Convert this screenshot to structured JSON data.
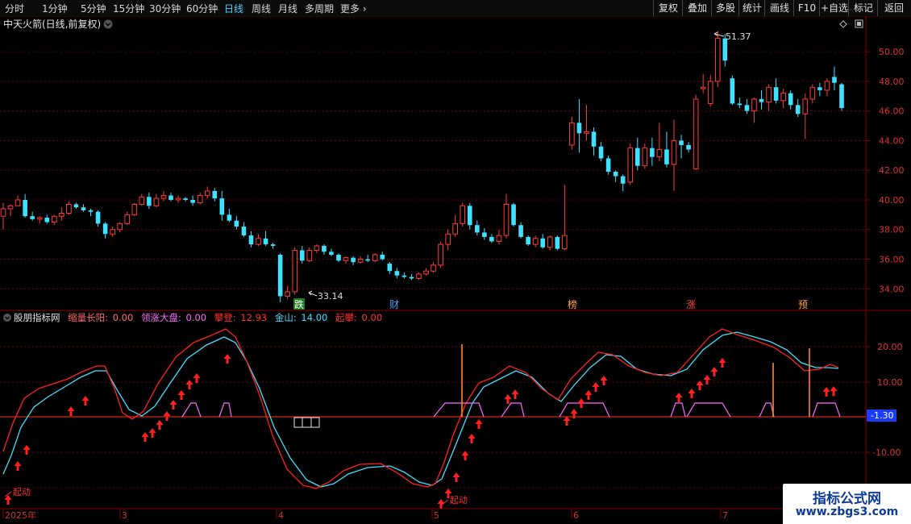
{
  "toolbar": {
    "periods": [
      "分时",
      "1分钟",
      "5分钟",
      "15分钟",
      "30分钟",
      "60分钟",
      "日线",
      "周线",
      "月线",
      "多周期",
      "更多"
    ],
    "active_period": "日线",
    "right_buttons": [
      "复权",
      "叠加",
      "多股",
      "统计",
      "画线",
      "F10",
      "+自选",
      "标记",
      "返回"
    ]
  },
  "header": {
    "title": "中天火箭(日线,前复权)"
  },
  "price_axis": {
    "ticks": [
      "50.00",
      "48.00",
      "46.00",
      "44.00",
      "42.00",
      "40.00",
      "38.00",
      "36.00",
      "34.00"
    ],
    "range": [
      32.6,
      52.4
    ]
  },
  "annotations": {
    "high_label": "51.37",
    "low_label": "33.14"
  },
  "events": [
    {
      "label": "跌",
      "fg": "#ffffff",
      "bg": "#1e7a1e"
    },
    {
      "label": "财",
      "fg": "#4aa3ff",
      "bg": "#000000"
    },
    {
      "label": "榜",
      "fg": "#ffa040",
      "bg": "#000000"
    },
    {
      "label": "涨",
      "fg": "#ff4040",
      "bg": "#000000"
    },
    {
      "label": "预",
      "fg": "#ffa040",
      "bg": "#000000"
    }
  ],
  "indicator": {
    "name": "股朋指标网",
    "fields": [
      {
        "label": "缩量长阳:",
        "value": "0.00",
        "color": "#ff6a6a"
      },
      {
        "label": "领涨大盘:",
        "value": "0.00",
        "color": "#ff66ff"
      },
      {
        "label": "攀登:",
        "value": "12.93",
        "color": "#ff3030"
      },
      {
        "label": "金山:",
        "value": "14.00",
        "color": "#40e0ff"
      },
      {
        "label": "起攀:",
        "value": "0.00",
        "color": "#ff3030"
      }
    ],
    "axis_ticks": [
      "20.00",
      "10.00",
      "-10.00"
    ],
    "current_value": "-1.30",
    "start_labels": [
      "起动",
      "起动"
    ]
  },
  "date_axis": {
    "labels": [
      "2025年",
      "3",
      "4",
      "5",
      "6",
      "7"
    ]
  },
  "watermark": {
    "line1": "指标公式网",
    "line2": "www.zbgs3.com"
  },
  "colors": {
    "up": "#ff3b3b",
    "down": "#40e0ff",
    "grid": "#6e0000"
  },
  "chart_data": {
    "type": "candlestick",
    "ylim": [
      32.6,
      52.4
    ],
    "candles": [
      [
        38.9,
        39.8,
        38.0,
        39.4
      ],
      [
        39.4,
        39.7,
        38.9,
        39.6
      ],
      [
        39.6,
        40.3,
        39.6,
        40.0
      ],
      [
        40.0,
        40.4,
        38.8,
        38.9
      ],
      [
        38.9,
        39.2,
        38.6,
        38.7
      ],
      [
        38.7,
        38.9,
        38.4,
        38.8
      ],
      [
        38.8,
        39.0,
        38.4,
        38.5
      ],
      [
        38.5,
        39.0,
        38.3,
        38.9
      ],
      [
        38.9,
        39.5,
        38.6,
        39.1
      ],
      [
        39.1,
        39.9,
        39.0,
        39.7
      ],
      [
        39.7,
        39.8,
        39.4,
        39.5
      ],
      [
        39.5,
        39.7,
        39.2,
        39.3
      ],
      [
        39.3,
        39.4,
        38.9,
        39.2
      ],
      [
        39.2,
        39.3,
        38.2,
        38.4
      ],
      [
        38.4,
        38.5,
        37.4,
        37.7
      ],
      [
        37.7,
        38.2,
        37.5,
        38.0
      ],
      [
        38.0,
        38.5,
        37.8,
        38.4
      ],
      [
        38.4,
        39.2,
        38.3,
        39.0
      ],
      [
        39.0,
        39.8,
        38.9,
        39.7
      ],
      [
        39.7,
        40.4,
        39.6,
        40.2
      ],
      [
        40.2,
        40.5,
        39.4,
        39.6
      ],
      [
        39.6,
        40.4,
        39.5,
        40.1
      ],
      [
        40.1,
        40.6,
        39.9,
        40.3
      ],
      [
        40.3,
        40.5,
        39.9,
        40.0
      ],
      [
        40.0,
        40.3,
        39.8,
        40.1
      ],
      [
        40.1,
        40.2,
        39.9,
        40.0
      ],
      [
        40.0,
        40.3,
        39.6,
        39.8
      ],
      [
        39.8,
        40.5,
        39.7,
        40.3
      ],
      [
        40.3,
        40.9,
        40.1,
        40.6
      ],
      [
        40.6,
        40.8,
        39.9,
        40.1
      ],
      [
        40.1,
        40.6,
        38.6,
        39.0
      ],
      [
        39.0,
        39.4,
        38.5,
        38.6
      ],
      [
        38.6,
        38.9,
        38.0,
        38.2
      ],
      [
        38.2,
        38.5,
        37.5,
        37.6
      ],
      [
        37.6,
        37.9,
        36.8,
        37.0
      ],
      [
        37.0,
        37.7,
        36.9,
        37.4
      ],
      [
        37.4,
        37.9,
        36.9,
        37.0
      ],
      [
        37.0,
        37.1,
        36.7,
        36.9
      ],
      [
        36.3,
        36.4,
        33.1,
        33.5
      ],
      [
        33.5,
        34.2,
        33.3,
        33.8
      ],
      [
        33.8,
        36.8,
        33.6,
        36.6
      ],
      [
        36.6,
        36.9,
        35.7,
        35.9
      ],
      [
        35.9,
        36.8,
        35.8,
        36.6
      ],
      [
        36.6,
        37.0,
        36.4,
        36.9
      ],
      [
        36.9,
        37.0,
        36.3,
        36.5
      ],
      [
        36.5,
        36.7,
        36.2,
        36.3
      ],
      [
        36.3,
        36.4,
        35.8,
        35.9
      ],
      [
        35.9,
        36.2,
        35.7,
        36.1
      ],
      [
        36.1,
        36.2,
        35.6,
        35.8
      ],
      [
        35.8,
        36.2,
        35.7,
        36.0
      ],
      [
        36.0,
        36.3,
        35.8,
        35.9
      ],
      [
        35.9,
        36.4,
        35.8,
        36.3
      ],
      [
        36.3,
        36.5,
        35.9,
        36.0
      ],
      [
        35.7,
        35.8,
        35.0,
        35.2
      ],
      [
        35.2,
        35.4,
        34.7,
        34.9
      ],
      [
        34.9,
        35.1,
        34.7,
        34.8
      ],
      [
        34.8,
        35.0,
        34.6,
        34.7
      ],
      [
        34.7,
        35.1,
        34.6,
        35.0
      ],
      [
        35.0,
        35.4,
        34.9,
        35.2
      ],
      [
        35.2,
        35.8,
        35.1,
        35.6
      ],
      [
        35.6,
        37.2,
        35.4,
        37.0
      ],
      [
        37.0,
        38.0,
        36.6,
        37.7
      ],
      [
        37.7,
        39.0,
        37.5,
        38.4
      ],
      [
        38.4,
        39.8,
        38.2,
        39.6
      ],
      [
        39.6,
        39.8,
        38.0,
        38.3
      ],
      [
        38.3,
        38.6,
        37.6,
        37.8
      ],
      [
        37.8,
        38.1,
        37.3,
        37.5
      ],
      [
        37.5,
        37.7,
        37.1,
        37.2
      ],
      [
        37.2,
        38.0,
        37.0,
        37.6
      ],
      [
        37.6,
        40.4,
        37.4,
        39.7
      ],
      [
        39.7,
        39.8,
        38.2,
        38.3
      ],
      [
        38.3,
        38.5,
        37.4,
        37.5
      ],
      [
        37.5,
        37.6,
        36.9,
        37.0
      ],
      [
        37.0,
        37.6,
        36.8,
        37.4
      ],
      [
        37.4,
        37.7,
        36.7,
        36.8
      ],
      [
        36.8,
        37.6,
        36.6,
        37.5
      ],
      [
        37.5,
        37.6,
        36.6,
        36.7
      ],
      [
        36.7,
        41.0,
        36.6,
        37.6
      ],
      [
        43.7,
        45.6,
        43.4,
        45.2
      ],
      [
        45.2,
        46.8,
        43.2,
        44.5
      ],
      [
        44.5,
        46.4,
        44.0,
        44.6
      ],
      [
        44.6,
        44.9,
        43.0,
        43.6
      ],
      [
        43.6,
        43.9,
        42.6,
        42.8
      ],
      [
        42.8,
        43.0,
        41.7,
        41.9
      ],
      [
        41.9,
        42.0,
        41.2,
        41.6
      ],
      [
        41.6,
        41.7,
        40.6,
        41.1
      ],
      [
        41.2,
        43.8,
        41.0,
        43.5
      ],
      [
        43.5,
        44.2,
        42.0,
        42.3
      ],
      [
        42.3,
        43.8,
        42.1,
        43.5
      ],
      [
        43.5,
        44.2,
        42.3,
        42.9
      ],
      [
        42.9,
        45.2,
        42.6,
        43.4
      ],
      [
        43.4,
        44.6,
        42.2,
        42.4
      ],
      [
        42.4,
        45.4,
        40.6,
        44.0
      ],
      [
        44.0,
        44.4,
        42.8,
        43.7
      ],
      [
        43.7,
        43.9,
        43.2,
        43.4
      ],
      [
        42.1,
        47.1,
        42.0,
        46.8
      ],
      [
        47.5,
        48.5,
        47.2,
        47.6
      ],
      [
        46.5,
        48.4,
        46.3,
        48.0
      ],
      [
        48.0,
        51.4,
        47.6,
        50.9
      ],
      [
        50.9,
        51.2,
        49.0,
        49.4
      ],
      [
        48.2,
        48.4,
        46.4,
        46.5
      ],
      [
        46.5,
        46.9,
        46.2,
        46.4
      ],
      [
        46.4,
        46.8,
        45.8,
        46.0
      ],
      [
        46.0,
        46.9,
        45.2,
        46.8
      ],
      [
        46.8,
        47.4,
        46.1,
        46.6
      ],
      [
        46.6,
        47.8,
        46.0,
        47.6
      ],
      [
        47.6,
        48.2,
        46.5,
        46.7
      ],
      [
        46.7,
        47.5,
        46.2,
        47.2
      ],
      [
        47.2,
        47.4,
        46.1,
        46.4
      ],
      [
        46.4,
        46.8,
        45.6,
        45.8
      ],
      [
        45.8,
        47.2,
        44.1,
        46.8
      ],
      [
        46.8,
        47.8,
        46.5,
        47.6
      ],
      [
        47.6,
        47.9,
        47.0,
        47.4
      ],
      [
        47.4,
        48.2,
        47.0,
        48.0
      ],
      [
        48.3,
        49.0,
        47.4,
        47.9
      ],
      [
        47.8,
        47.9,
        46.0,
        46.2
      ]
    ]
  }
}
